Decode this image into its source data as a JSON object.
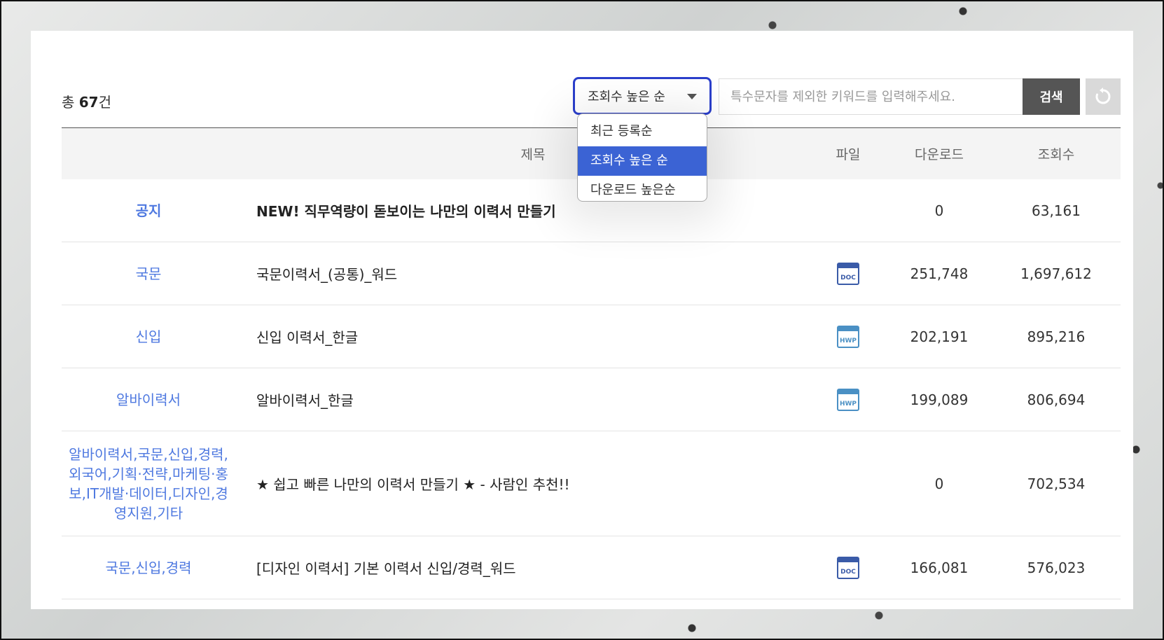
{
  "summary": {
    "prefix": "총 ",
    "count": "67",
    "suffix": "건"
  },
  "sort": {
    "selected": "조회수 높은 순",
    "options": [
      "최근 등록순",
      "조회수 높은 순",
      "다운로드 높은순"
    ]
  },
  "search": {
    "placeholder": "특수문자를 제외한 키워드를 입력해주세요.",
    "button_label": "검색"
  },
  "table": {
    "headers": {
      "title": "제목",
      "file": "파일",
      "downloads": "다운로드",
      "views": "조회수"
    },
    "rows": [
      {
        "category": "공지",
        "title": "NEW! 직무역량이 돋보이는 나만의 이력서 만들기",
        "file": "",
        "downloads": "0",
        "views": "63,161"
      },
      {
        "category": "국문",
        "title": "국문이력서_(공통)_워드",
        "file": "doc-icon",
        "downloads": "251,748",
        "views": "1,697,612"
      },
      {
        "category": "신입",
        "title": "신입 이력서_한글",
        "file": "hwp-icon",
        "downloads": "202,191",
        "views": "895,216"
      },
      {
        "category": "알바이력서",
        "title": "알바이력서_한글",
        "file": "hwp-icon",
        "downloads": "199,089",
        "views": "806,694"
      },
      {
        "category": "알바이력서,국문,신입,경력,외국어,기획·전략,마케팅·홍보,IT개발·데이터,디자인,경영지원,기타",
        "title": "★ 쉽고 빠른 나만의 이력서 만들기 ★ - 사람인 추천!!",
        "file": "",
        "downloads": "0",
        "views": "702,534"
      },
      {
        "category": "국문,신입,경력",
        "title": "[디자인 이력서] 기본 이력서 신입/경력_워드",
        "file": "doc-icon",
        "downloads": "166,081",
        "views": "576,023"
      }
    ]
  },
  "colors": {
    "accent": "#2b3fcb",
    "selected_option": "#3b63d4",
    "category_link": "#4f79e0",
    "doc_icon": "#3a5ba8",
    "hwp_icon": "#4a90c4"
  }
}
